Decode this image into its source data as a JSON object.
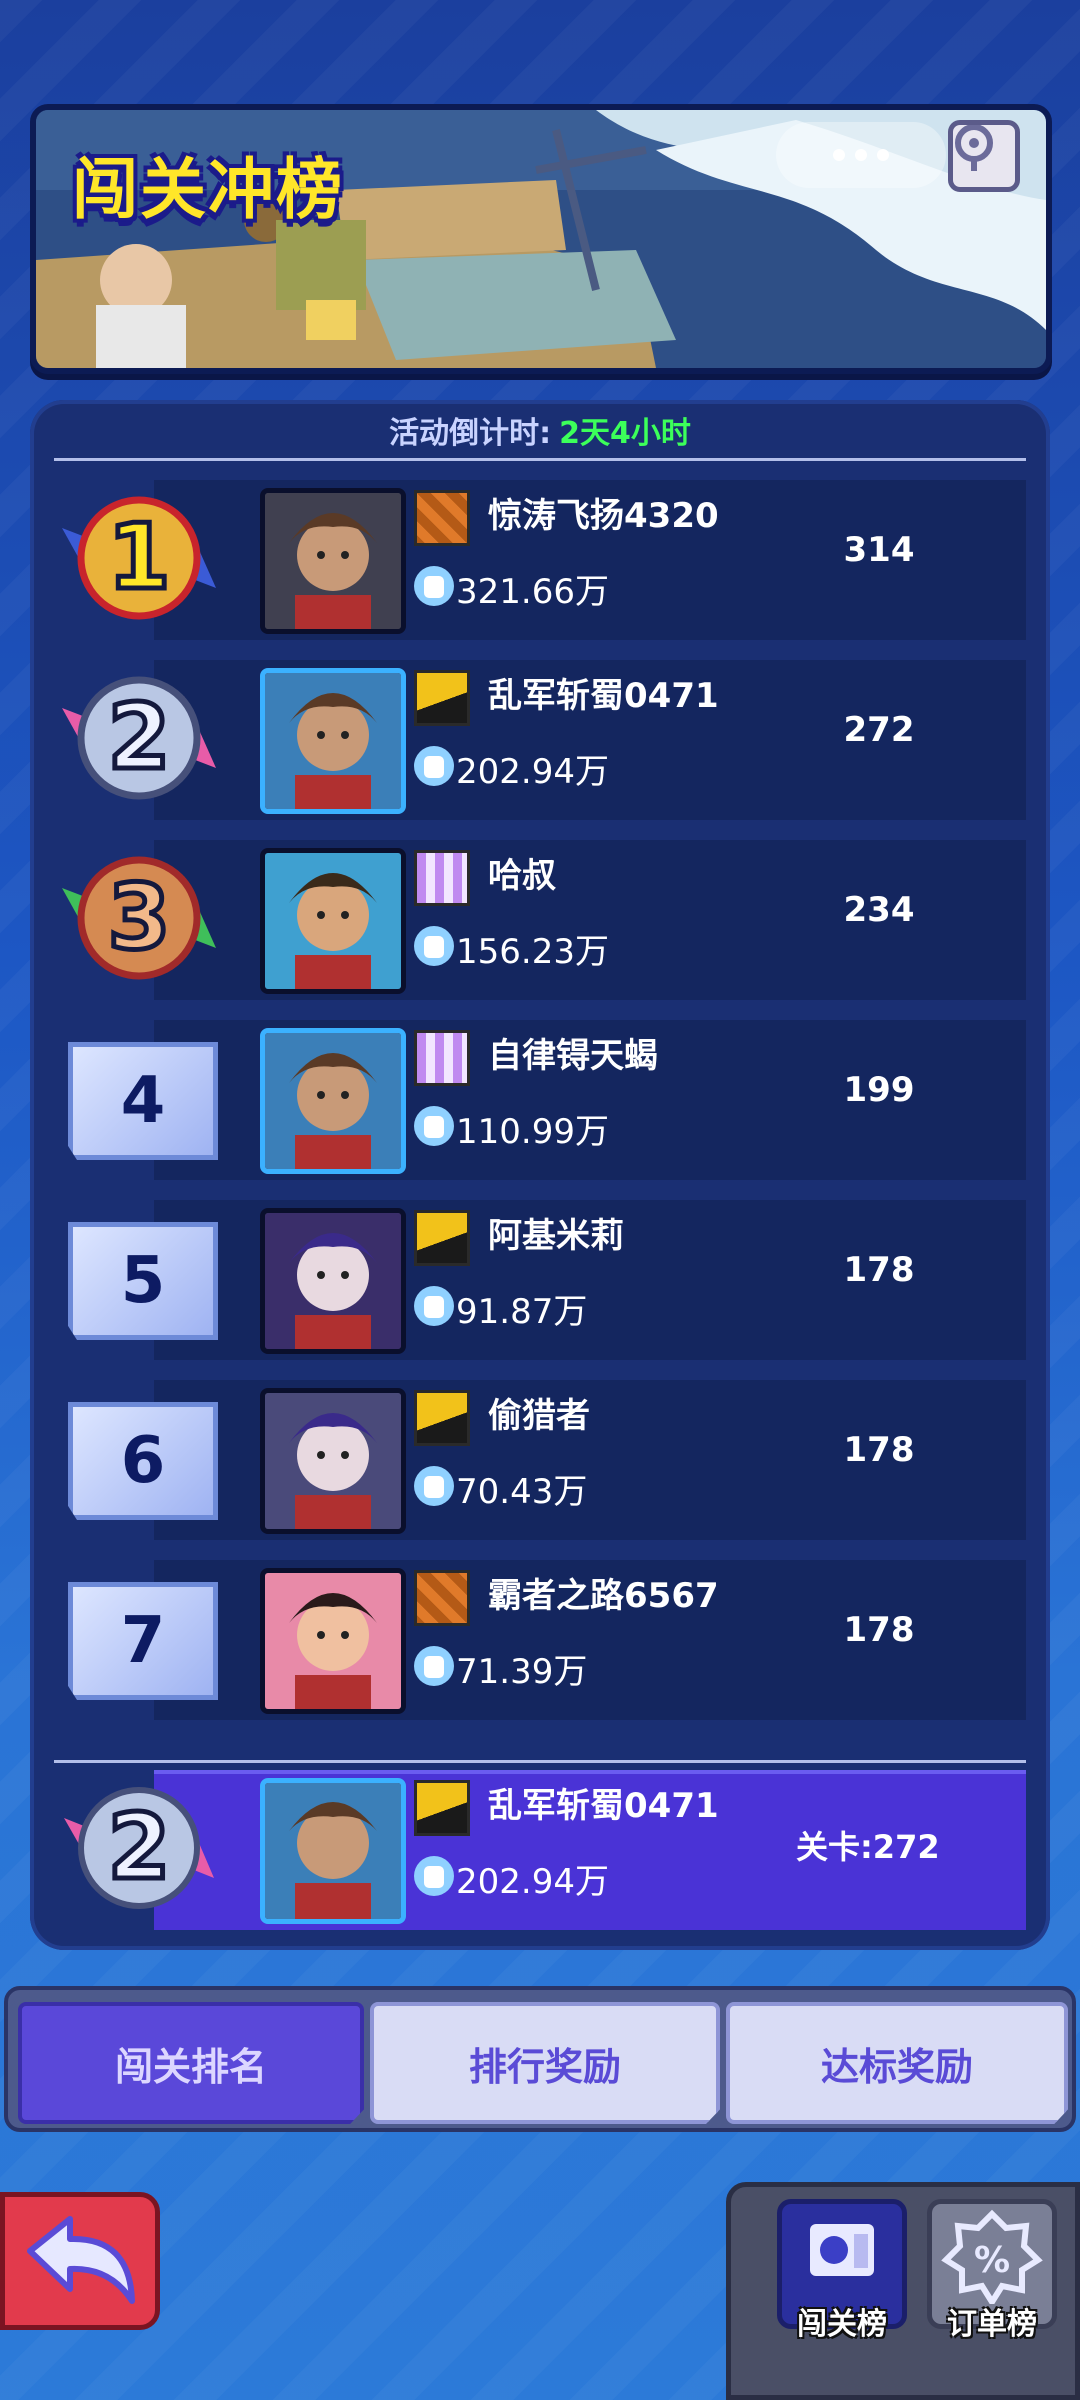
{
  "banner": {
    "title": "闯关冲榜"
  },
  "countdown": {
    "label": "活动倒计时:",
    "value": "2天4小时"
  },
  "players": [
    {
      "rank": "1",
      "name": "惊涛飞扬4320",
      "power": "321.66万",
      "score": "314",
      "flag": "orange"
    },
    {
      "rank": "2",
      "name": "乱军斩蜀0471",
      "power": "202.94万",
      "score": "272",
      "flag": "yellow"
    },
    {
      "rank": "3",
      "name": "哈叔",
      "power": "156.23万",
      "score": "234",
      "flag": "purple"
    },
    {
      "rank": "4",
      "name": "自律锝天蝎",
      "power": "110.99万",
      "score": "199",
      "flag": "purple"
    },
    {
      "rank": "5",
      "name": "阿基米莉",
      "power": "91.87万",
      "score": "178",
      "flag": "yellow"
    },
    {
      "rank": "6",
      "name": "偷猎者",
      "power": "70.43万",
      "score": "178",
      "flag": "yellow"
    },
    {
      "rank": "7",
      "name": "霸者之路6567",
      "power": "71.39万",
      "score": "178",
      "flag": "orange"
    }
  ],
  "me": {
    "rank": "2",
    "name": "乱军斩蜀0471",
    "power": "202.94万",
    "level_label": "关卡:272"
  },
  "tabs": [
    "闯关排名",
    "排行奖励",
    "达标奖励"
  ],
  "dock": {
    "btn1_label": "闯关榜",
    "btn2_label": "订单榜"
  },
  "icons": {
    "back": "back-arrow-icon",
    "target": "target-icon",
    "power": "fist-icon"
  },
  "colors": {
    "countdown_value": "#3cff5a",
    "gold": "#ffe629",
    "active_tab": "#5a48d9"
  }
}
